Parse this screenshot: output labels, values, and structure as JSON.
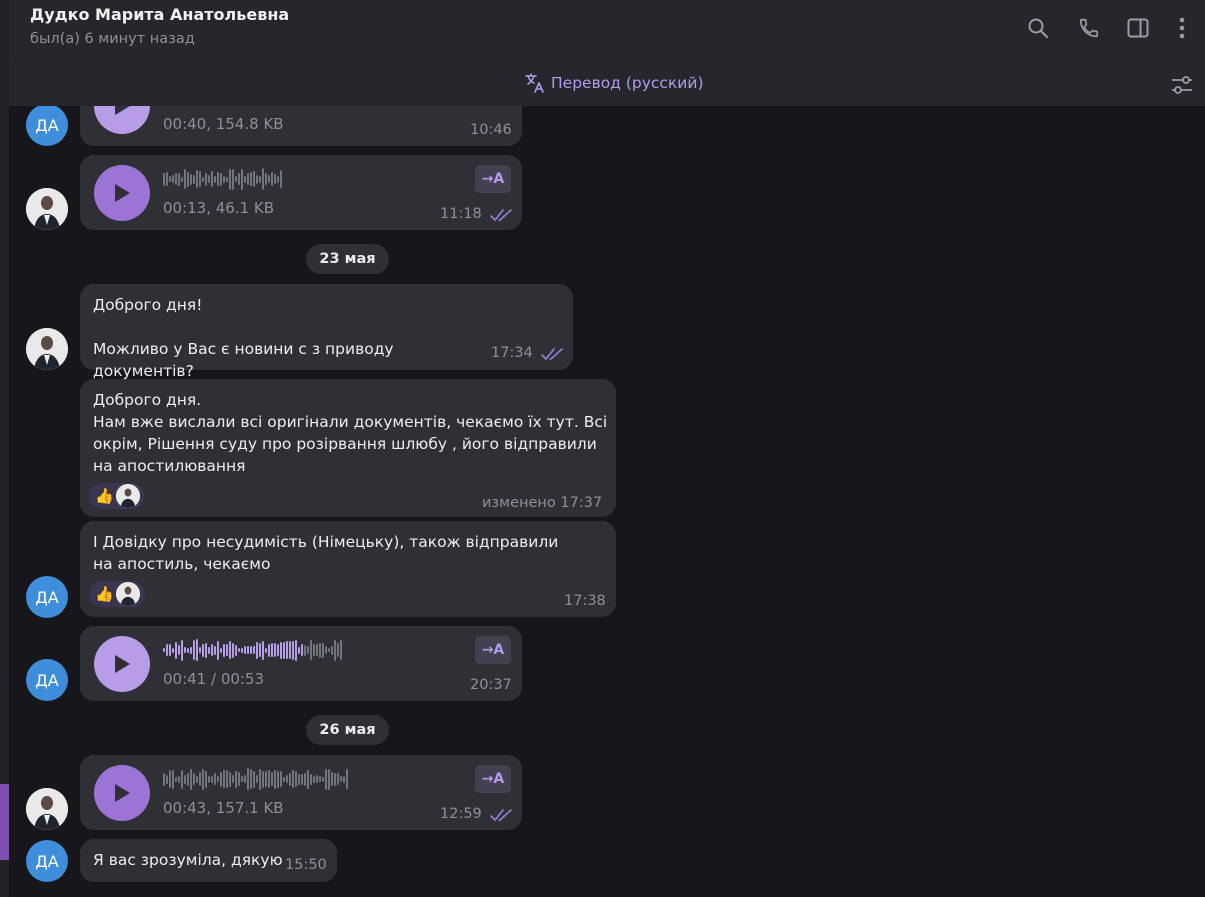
{
  "chat": {
    "title": "Дудко Марита Анатольевна",
    "status": "был(а) 6 минут назад"
  },
  "header_icons": [
    "search-icon",
    "phone-icon",
    "sidebar-toggle-icon",
    "more-vertical-icon"
  ],
  "translate_bar": {
    "label": "Перевод (русский)",
    "icon": "translate-icon",
    "settings_icon": "settings-sliders-icon"
  },
  "colors": {
    "accent": "#b59aeb",
    "play_button": "#9b74d6",
    "bubble": "#2f3035",
    "avatar_da": "#3f8edc"
  },
  "avatar_initials": "ДА",
  "messages": [
    {
      "type": "voice",
      "sender": "ДА",
      "meta": "00:40, 154.8 KB",
      "time": "10:46"
    },
    {
      "type": "voice",
      "sender": "me",
      "meta": "00:13, 46.1 KB",
      "time": "11:18",
      "translate_label": "→A",
      "read": true
    },
    {
      "type": "date",
      "label": "23 мая"
    },
    {
      "type": "text",
      "sender": "me",
      "text": "Доброго дня!\n\nМожливо у Вас є новини с з приводу документів?",
      "time": "17:34",
      "read": true
    },
    {
      "type": "text",
      "sender": "ДА",
      "text": "Доброго дня.\nНам вже вислали всі оригінали документів, чекаємо їх тут. Всі окрім, Рішення суду про розірвання шлюбу , його відправили на апостилювання",
      "time": "изменено 17:37",
      "reaction": "👍"
    },
    {
      "type": "text",
      "sender": "ДА",
      "text": "І Довідку про несудимість (Німецьку), також відправили на апостиль, чекаємо",
      "time": "17:38",
      "reaction": "👍"
    },
    {
      "type": "voice",
      "sender": "ДА",
      "meta": "00:41 / 00:53",
      "time": "20:37",
      "translate_label": "→A"
    },
    {
      "type": "date",
      "label": "26 мая"
    },
    {
      "type": "voice",
      "sender": "me",
      "meta": "00:43, 157.1 KB",
      "time": "12:59",
      "translate_label": "→A",
      "read": true
    },
    {
      "type": "text",
      "sender": "ДА",
      "text": "Я вас зрозуміла, дякую",
      "time": "15:50"
    }
  ]
}
